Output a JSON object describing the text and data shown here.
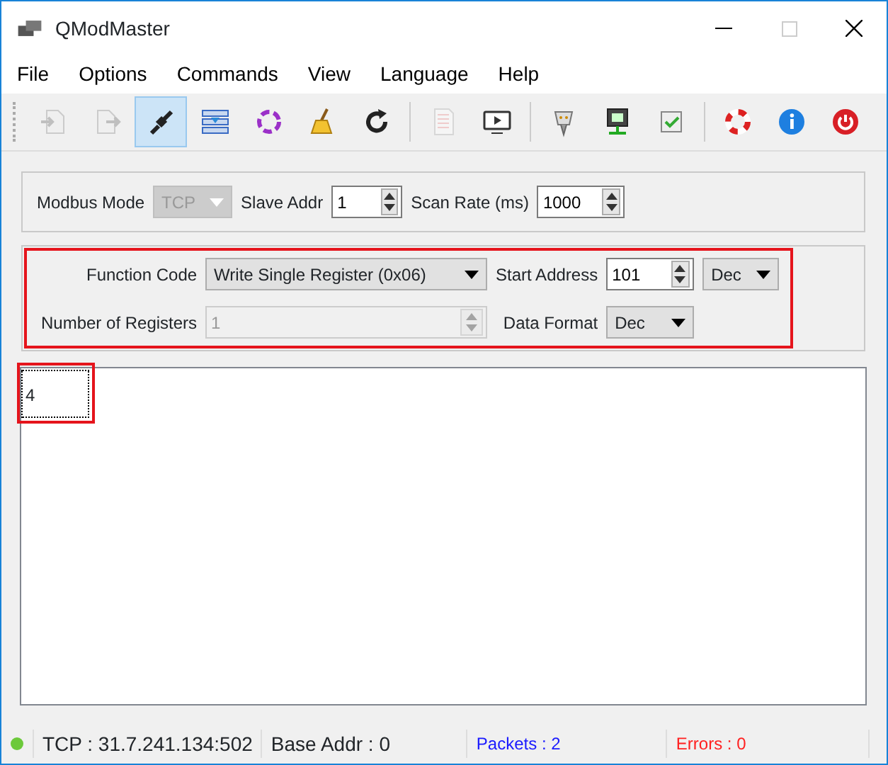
{
  "window": {
    "title": "QModMaster"
  },
  "menu": [
    "File",
    "Options",
    "Commands",
    "View",
    "Language",
    "Help"
  ],
  "toolbar": [
    [
      {
        "disabled": true,
        "selected": false
      },
      {
        "disabled": true,
        "selected": false
      },
      {
        "disabled": false,
        "selected": true
      },
      {
        "disabled": false,
        "selected": false
      },
      {
        "disabled": false,
        "selected": false
      },
      {
        "disabled": false,
        "selected": false
      },
      {
        "disabled": false,
        "selected": false
      }
    ],
    [
      {
        "disabled": true,
        "selected": false
      },
      {
        "disabled": false,
        "selected": false
      }
    ],
    [
      {
        "disabled": false,
        "selected": false
      },
      {
        "disabled": false,
        "selected": false
      },
      {
        "disabled": false,
        "selected": false
      }
    ],
    [
      {
        "disabled": false,
        "selected": false
      },
      {
        "disabled": false,
        "selected": false
      },
      {
        "disabled": false,
        "selected": false
      }
    ]
  ],
  "connection": {
    "mode_label": "Modbus Mode",
    "mode": "TCP",
    "mode_disabled": true,
    "slave_label": "Slave Addr",
    "slave": "1",
    "scan_label": "Scan Rate (ms)",
    "scan": "1000"
  },
  "request": {
    "highlighted": true,
    "function_label": "Function Code",
    "function": "Write Single Register (0x06)",
    "start_label": "Start Address",
    "start": "101",
    "start_format": "Dec",
    "count_label": "Number of Registers",
    "count": "1",
    "count_disabled": true,
    "format_label": "Data Format",
    "format": "Dec"
  },
  "registers": [
    {
      "value": "4",
      "highlighted": true
    }
  ],
  "status_bar": {
    "connected": true,
    "connection": "TCP : 31.7.241.134:502",
    "base": "Base Addr : 0",
    "packets": "Packets : 2",
    "errors": "Errors : 0"
  }
}
